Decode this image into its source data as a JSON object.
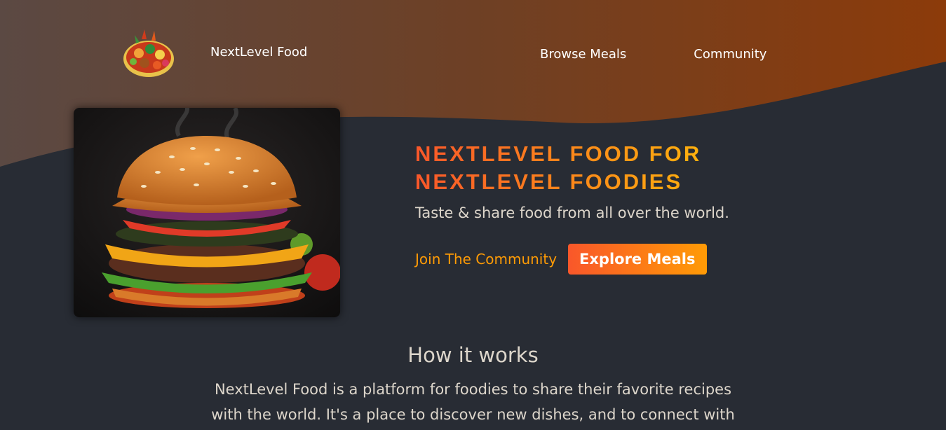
{
  "header": {
    "brand_name": "NextLevel Food",
    "logo_icon": "food-platter-icon",
    "nav": [
      {
        "label": "Browse Meals"
      },
      {
        "label": "Community"
      }
    ]
  },
  "hero": {
    "image_icon": "burger-photo",
    "title": "NEXTLEVEL FOOD FOR NEXTLEVEL FOODIES",
    "subtitle": "Taste & share food from all over the world.",
    "join_link": "Join The Community",
    "explore_button": "Explore Meals"
  },
  "how_it_works": {
    "title": "How it works",
    "text": "NextLevel Food is a platform for foodies to share their favorite recipes with the world. It's a place to discover new dishes, and to connect with"
  },
  "colors": {
    "background": "#282c34",
    "header_gradient_start": "#5a4a42",
    "header_gradient_end": "#8c3c08",
    "accent_orange": "#f9572a",
    "accent_yellow": "#ff9b05",
    "text": "#ddd6cb"
  }
}
